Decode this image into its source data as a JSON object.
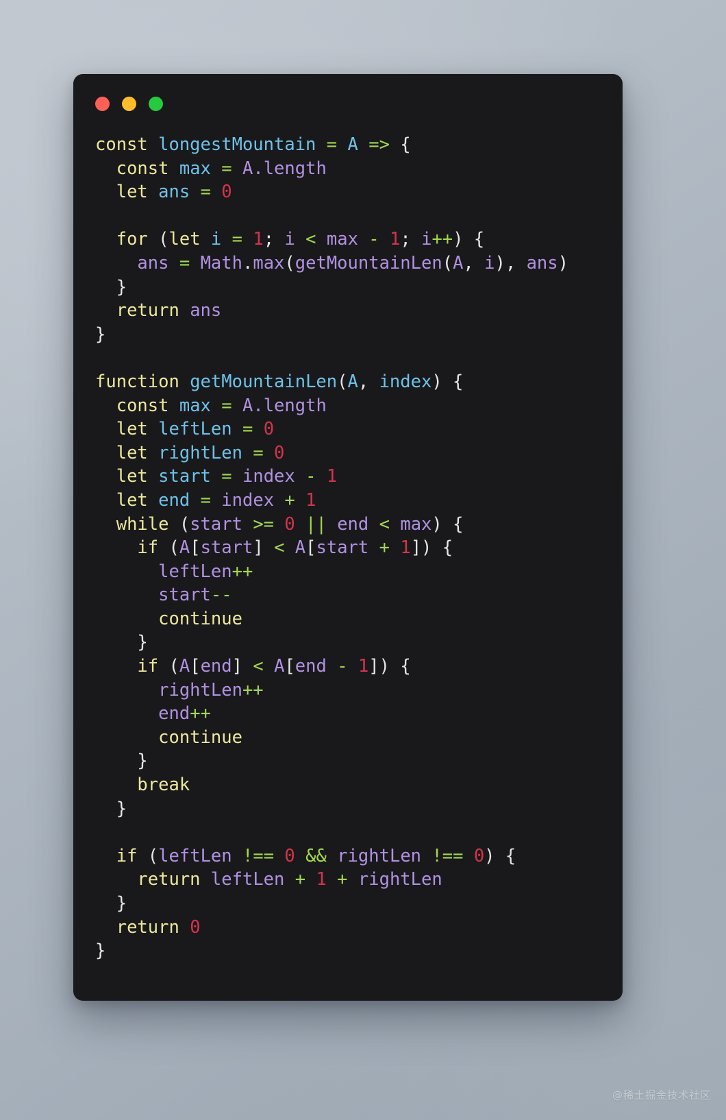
{
  "window": {
    "traffic_lights": [
      {
        "name": "close",
        "color": "#ff5f56"
      },
      {
        "name": "minimize",
        "color": "#ffbd2e"
      },
      {
        "name": "maximize",
        "color": "#27c93f"
      }
    ]
  },
  "editor": {
    "language": "javascript",
    "background": "#19191c",
    "token_colors": {
      "keyword": "#ede89a",
      "declaration": "#6ec2e8",
      "variable": "#b191e0",
      "operator": "#a4d94b",
      "number": "#d4344a",
      "punctuation": "#e6e6e6"
    },
    "lines": [
      [
        {
          "t": "const",
          "c": "kw"
        },
        {
          "t": " ",
          "c": "pun"
        },
        {
          "t": "longestMountain",
          "c": "def"
        },
        {
          "t": " ",
          "c": "pun"
        },
        {
          "t": "=",
          "c": "op"
        },
        {
          "t": " ",
          "c": "pun"
        },
        {
          "t": "A",
          "c": "def"
        },
        {
          "t": " ",
          "c": "pun"
        },
        {
          "t": "=>",
          "c": "op"
        },
        {
          "t": " ",
          "c": "pun"
        },
        {
          "t": "{",
          "c": "pun"
        }
      ],
      [
        {
          "t": "  ",
          "c": "pun"
        },
        {
          "t": "const",
          "c": "kw"
        },
        {
          "t": " ",
          "c": "pun"
        },
        {
          "t": "max",
          "c": "def"
        },
        {
          "t": " ",
          "c": "pun"
        },
        {
          "t": "=",
          "c": "op"
        },
        {
          "t": " ",
          "c": "pun"
        },
        {
          "t": "A.length",
          "c": "var"
        }
      ],
      [
        {
          "t": "  ",
          "c": "pun"
        },
        {
          "t": "let",
          "c": "kw"
        },
        {
          "t": " ",
          "c": "pun"
        },
        {
          "t": "ans",
          "c": "def"
        },
        {
          "t": " ",
          "c": "pun"
        },
        {
          "t": "=",
          "c": "op"
        },
        {
          "t": " ",
          "c": "pun"
        },
        {
          "t": "0",
          "c": "num"
        }
      ],
      [],
      [
        {
          "t": "  ",
          "c": "pun"
        },
        {
          "t": "for",
          "c": "kw"
        },
        {
          "t": " (",
          "c": "pun"
        },
        {
          "t": "let",
          "c": "kw"
        },
        {
          "t": " ",
          "c": "pun"
        },
        {
          "t": "i",
          "c": "def"
        },
        {
          "t": " ",
          "c": "pun"
        },
        {
          "t": "=",
          "c": "op"
        },
        {
          "t": " ",
          "c": "pun"
        },
        {
          "t": "1",
          "c": "num"
        },
        {
          "t": "; ",
          "c": "pun"
        },
        {
          "t": "i",
          "c": "var"
        },
        {
          "t": " ",
          "c": "pun"
        },
        {
          "t": "<",
          "c": "op"
        },
        {
          "t": " ",
          "c": "pun"
        },
        {
          "t": "max",
          "c": "var"
        },
        {
          "t": " ",
          "c": "pun"
        },
        {
          "t": "-",
          "c": "op"
        },
        {
          "t": " ",
          "c": "pun"
        },
        {
          "t": "1",
          "c": "num"
        },
        {
          "t": "; ",
          "c": "pun"
        },
        {
          "t": "i",
          "c": "var"
        },
        {
          "t": "++",
          "c": "op"
        },
        {
          "t": ") {",
          "c": "pun"
        }
      ],
      [
        {
          "t": "    ",
          "c": "pun"
        },
        {
          "t": "ans",
          "c": "var"
        },
        {
          "t": " ",
          "c": "pun"
        },
        {
          "t": "=",
          "c": "op"
        },
        {
          "t": " ",
          "c": "pun"
        },
        {
          "t": "Math",
          "c": "var"
        },
        {
          "t": ".",
          "c": "pun"
        },
        {
          "t": "max",
          "c": "var"
        },
        {
          "t": "(",
          "c": "pun"
        },
        {
          "t": "getMountainLen",
          "c": "var"
        },
        {
          "t": "(",
          "c": "pun"
        },
        {
          "t": "A",
          "c": "var"
        },
        {
          "t": ", ",
          "c": "pun"
        },
        {
          "t": "i",
          "c": "var"
        },
        {
          "t": "), ",
          "c": "pun"
        },
        {
          "t": "ans",
          "c": "var"
        },
        {
          "t": ")",
          "c": "pun"
        }
      ],
      [
        {
          "t": "  }",
          "c": "pun"
        }
      ],
      [
        {
          "t": "  ",
          "c": "pun"
        },
        {
          "t": "return",
          "c": "kw"
        },
        {
          "t": " ",
          "c": "pun"
        },
        {
          "t": "ans",
          "c": "var"
        }
      ],
      [
        {
          "t": "}",
          "c": "pun"
        }
      ],
      [],
      [
        {
          "t": "function",
          "c": "kw"
        },
        {
          "t": " ",
          "c": "pun"
        },
        {
          "t": "getMountainLen",
          "c": "def"
        },
        {
          "t": "(",
          "c": "pun"
        },
        {
          "t": "A",
          "c": "def"
        },
        {
          "t": ", ",
          "c": "pun"
        },
        {
          "t": "index",
          "c": "def"
        },
        {
          "t": ") {",
          "c": "pun"
        }
      ],
      [
        {
          "t": "  ",
          "c": "pun"
        },
        {
          "t": "const",
          "c": "kw"
        },
        {
          "t": " ",
          "c": "pun"
        },
        {
          "t": "max",
          "c": "def"
        },
        {
          "t": " ",
          "c": "pun"
        },
        {
          "t": "=",
          "c": "op"
        },
        {
          "t": " ",
          "c": "pun"
        },
        {
          "t": "A.length",
          "c": "var"
        }
      ],
      [
        {
          "t": "  ",
          "c": "pun"
        },
        {
          "t": "let",
          "c": "kw"
        },
        {
          "t": " ",
          "c": "pun"
        },
        {
          "t": "leftLen",
          "c": "def"
        },
        {
          "t": " ",
          "c": "pun"
        },
        {
          "t": "=",
          "c": "op"
        },
        {
          "t": " ",
          "c": "pun"
        },
        {
          "t": "0",
          "c": "num"
        }
      ],
      [
        {
          "t": "  ",
          "c": "pun"
        },
        {
          "t": "let",
          "c": "kw"
        },
        {
          "t": " ",
          "c": "pun"
        },
        {
          "t": "rightLen",
          "c": "def"
        },
        {
          "t": " ",
          "c": "pun"
        },
        {
          "t": "=",
          "c": "op"
        },
        {
          "t": " ",
          "c": "pun"
        },
        {
          "t": "0",
          "c": "num"
        }
      ],
      [
        {
          "t": "  ",
          "c": "pun"
        },
        {
          "t": "let",
          "c": "kw"
        },
        {
          "t": " ",
          "c": "pun"
        },
        {
          "t": "start",
          "c": "def"
        },
        {
          "t": " ",
          "c": "pun"
        },
        {
          "t": "=",
          "c": "op"
        },
        {
          "t": " ",
          "c": "pun"
        },
        {
          "t": "index",
          "c": "var"
        },
        {
          "t": " ",
          "c": "pun"
        },
        {
          "t": "-",
          "c": "op"
        },
        {
          "t": " ",
          "c": "pun"
        },
        {
          "t": "1",
          "c": "num"
        }
      ],
      [
        {
          "t": "  ",
          "c": "pun"
        },
        {
          "t": "let",
          "c": "kw"
        },
        {
          "t": " ",
          "c": "pun"
        },
        {
          "t": "end",
          "c": "def"
        },
        {
          "t": " ",
          "c": "pun"
        },
        {
          "t": "=",
          "c": "op"
        },
        {
          "t": " ",
          "c": "pun"
        },
        {
          "t": "index",
          "c": "var"
        },
        {
          "t": " ",
          "c": "pun"
        },
        {
          "t": "+",
          "c": "op"
        },
        {
          "t": " ",
          "c": "pun"
        },
        {
          "t": "1",
          "c": "num"
        }
      ],
      [
        {
          "t": "  ",
          "c": "pun"
        },
        {
          "t": "while",
          "c": "kw"
        },
        {
          "t": " (",
          "c": "pun"
        },
        {
          "t": "start",
          "c": "var"
        },
        {
          "t": " ",
          "c": "pun"
        },
        {
          "t": ">=",
          "c": "op"
        },
        {
          "t": " ",
          "c": "pun"
        },
        {
          "t": "0",
          "c": "num"
        },
        {
          "t": " ",
          "c": "pun"
        },
        {
          "t": "||",
          "c": "op"
        },
        {
          "t": " ",
          "c": "pun"
        },
        {
          "t": "end",
          "c": "var"
        },
        {
          "t": " ",
          "c": "pun"
        },
        {
          "t": "<",
          "c": "op"
        },
        {
          "t": " ",
          "c": "pun"
        },
        {
          "t": "max",
          "c": "var"
        },
        {
          "t": ") {",
          "c": "pun"
        }
      ],
      [
        {
          "t": "    ",
          "c": "pun"
        },
        {
          "t": "if",
          "c": "kw"
        },
        {
          "t": " (",
          "c": "pun"
        },
        {
          "t": "A",
          "c": "var"
        },
        {
          "t": "[",
          "c": "pun"
        },
        {
          "t": "start",
          "c": "var"
        },
        {
          "t": "]",
          "c": "pun"
        },
        {
          "t": " ",
          "c": "pun"
        },
        {
          "t": "<",
          "c": "op"
        },
        {
          "t": " ",
          "c": "pun"
        },
        {
          "t": "A",
          "c": "var"
        },
        {
          "t": "[",
          "c": "pun"
        },
        {
          "t": "start",
          "c": "var"
        },
        {
          "t": " ",
          "c": "pun"
        },
        {
          "t": "+",
          "c": "op"
        },
        {
          "t": " ",
          "c": "pun"
        },
        {
          "t": "1",
          "c": "num"
        },
        {
          "t": "]) {",
          "c": "pun"
        }
      ],
      [
        {
          "t": "      ",
          "c": "pun"
        },
        {
          "t": "leftLen",
          "c": "var"
        },
        {
          "t": "++",
          "c": "op"
        }
      ],
      [
        {
          "t": "      ",
          "c": "pun"
        },
        {
          "t": "start",
          "c": "var"
        },
        {
          "t": "--",
          "c": "op"
        }
      ],
      [
        {
          "t": "      ",
          "c": "pun"
        },
        {
          "t": "continue",
          "c": "kw"
        }
      ],
      [
        {
          "t": "    }",
          "c": "pun"
        }
      ],
      [
        {
          "t": "    ",
          "c": "pun"
        },
        {
          "t": "if",
          "c": "kw"
        },
        {
          "t": " (",
          "c": "pun"
        },
        {
          "t": "A",
          "c": "var"
        },
        {
          "t": "[",
          "c": "pun"
        },
        {
          "t": "end",
          "c": "var"
        },
        {
          "t": "]",
          "c": "pun"
        },
        {
          "t": " ",
          "c": "pun"
        },
        {
          "t": "<",
          "c": "op"
        },
        {
          "t": " ",
          "c": "pun"
        },
        {
          "t": "A",
          "c": "var"
        },
        {
          "t": "[",
          "c": "pun"
        },
        {
          "t": "end",
          "c": "var"
        },
        {
          "t": " ",
          "c": "pun"
        },
        {
          "t": "-",
          "c": "op"
        },
        {
          "t": " ",
          "c": "pun"
        },
        {
          "t": "1",
          "c": "num"
        },
        {
          "t": "]) {",
          "c": "pun"
        }
      ],
      [
        {
          "t": "      ",
          "c": "pun"
        },
        {
          "t": "rightLen",
          "c": "var"
        },
        {
          "t": "++",
          "c": "op"
        }
      ],
      [
        {
          "t": "      ",
          "c": "pun"
        },
        {
          "t": "end",
          "c": "var"
        },
        {
          "t": "++",
          "c": "op"
        }
      ],
      [
        {
          "t": "      ",
          "c": "pun"
        },
        {
          "t": "continue",
          "c": "kw"
        }
      ],
      [
        {
          "t": "    }",
          "c": "pun"
        }
      ],
      [
        {
          "t": "    ",
          "c": "pun"
        },
        {
          "t": "break",
          "c": "kw"
        }
      ],
      [
        {
          "t": "  }",
          "c": "pun"
        }
      ],
      [],
      [
        {
          "t": "  ",
          "c": "pun"
        },
        {
          "t": "if",
          "c": "kw"
        },
        {
          "t": " (",
          "c": "pun"
        },
        {
          "t": "leftLen",
          "c": "var"
        },
        {
          "t": " ",
          "c": "pun"
        },
        {
          "t": "!==",
          "c": "op"
        },
        {
          "t": " ",
          "c": "pun"
        },
        {
          "t": "0",
          "c": "num"
        },
        {
          "t": " ",
          "c": "pun"
        },
        {
          "t": "&&",
          "c": "op"
        },
        {
          "t": " ",
          "c": "pun"
        },
        {
          "t": "rightLen",
          "c": "var"
        },
        {
          "t": " ",
          "c": "pun"
        },
        {
          "t": "!==",
          "c": "op"
        },
        {
          "t": " ",
          "c": "pun"
        },
        {
          "t": "0",
          "c": "num"
        },
        {
          "t": ") {",
          "c": "pun"
        }
      ],
      [
        {
          "t": "    ",
          "c": "pun"
        },
        {
          "t": "return",
          "c": "kw"
        },
        {
          "t": " ",
          "c": "pun"
        },
        {
          "t": "leftLen",
          "c": "var"
        },
        {
          "t": " ",
          "c": "pun"
        },
        {
          "t": "+",
          "c": "op"
        },
        {
          "t": " ",
          "c": "pun"
        },
        {
          "t": "1",
          "c": "num"
        },
        {
          "t": " ",
          "c": "pun"
        },
        {
          "t": "+",
          "c": "op"
        },
        {
          "t": " ",
          "c": "pun"
        },
        {
          "t": "rightLen",
          "c": "var"
        }
      ],
      [
        {
          "t": "  }",
          "c": "pun"
        }
      ],
      [
        {
          "t": "  ",
          "c": "pun"
        },
        {
          "t": "return",
          "c": "kw"
        },
        {
          "t": " ",
          "c": "pun"
        },
        {
          "t": "0",
          "c": "num"
        }
      ],
      [
        {
          "t": "}",
          "c": "pun"
        }
      ]
    ],
    "plain_text": "const longestMountain = A => {\n  const max = A.length\n  let ans = 0\n\n  for (let i = 1; i < max - 1; i++) {\n    ans = Math.max(getMountainLen(A, i), ans)\n  }\n  return ans\n}\n\nfunction getMountainLen(A, index) {\n  const max = A.length\n  let leftLen = 0\n  let rightLen = 0\n  let start = index - 1\n  let end = index + 1\n  while (start >= 0 || end < max) {\n    if (A[start] < A[start + 1]) {\n      leftLen++\n      start--\n      continue\n    }\n    if (A[end] < A[end - 1]) {\n      rightLen++\n      end++\n      continue\n    }\n    break\n  }\n\n  if (leftLen !== 0 && rightLen !== 0) {\n    return leftLen + 1 + rightLen\n  }\n  return 0\n}"
  },
  "watermark": {
    "text": "@稀土掘金技术社区"
  }
}
